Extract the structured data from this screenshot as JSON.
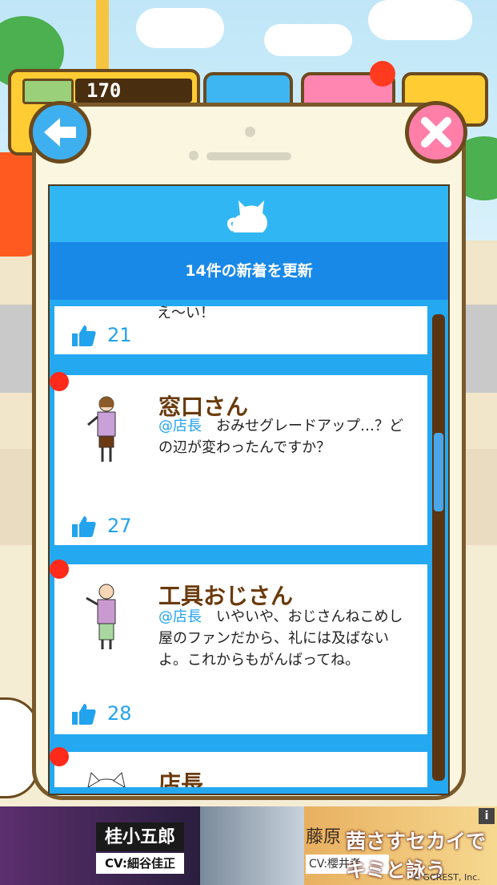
{
  "status": {
    "money": "170"
  },
  "screen": {
    "banner": "14件の新着を更新"
  },
  "posts": [
    {
      "name": "",
      "message_tail": "え〜い！",
      "likes": "21"
    },
    {
      "name": "窓口さん",
      "mention": "@店長",
      "message": "おみせグレードアップ…？どの辺が変わったんですか？",
      "likes": "27"
    },
    {
      "name": "工具おじさん",
      "mention": "@店長",
      "message": "いやいや、おじさんねこめし屋のファンだから、礼には及ばないよ。これからもがんばってね。",
      "likes": "28"
    },
    {
      "name": "店長"
    }
  ],
  "ad": {
    "char1_name": "桂小五郎",
    "char1_cv": "CV:細谷佳正",
    "char2_name": "藤原",
    "char2_cv": "CV:櫻井孝",
    "title": "茜さすセカイでキミと詠う",
    "copyright": "© GCREST, Inc.",
    "info": "i"
  },
  "colors": {
    "accent": "#22a3ee",
    "name": "#6a3a0c",
    "notify": "#ff2a1a",
    "frame": "#7a5a2a"
  },
  "icons": {
    "back": "arrow-left-icon",
    "close": "close-icon",
    "like": "thumbs-up-icon",
    "cat": "cat-icon"
  }
}
